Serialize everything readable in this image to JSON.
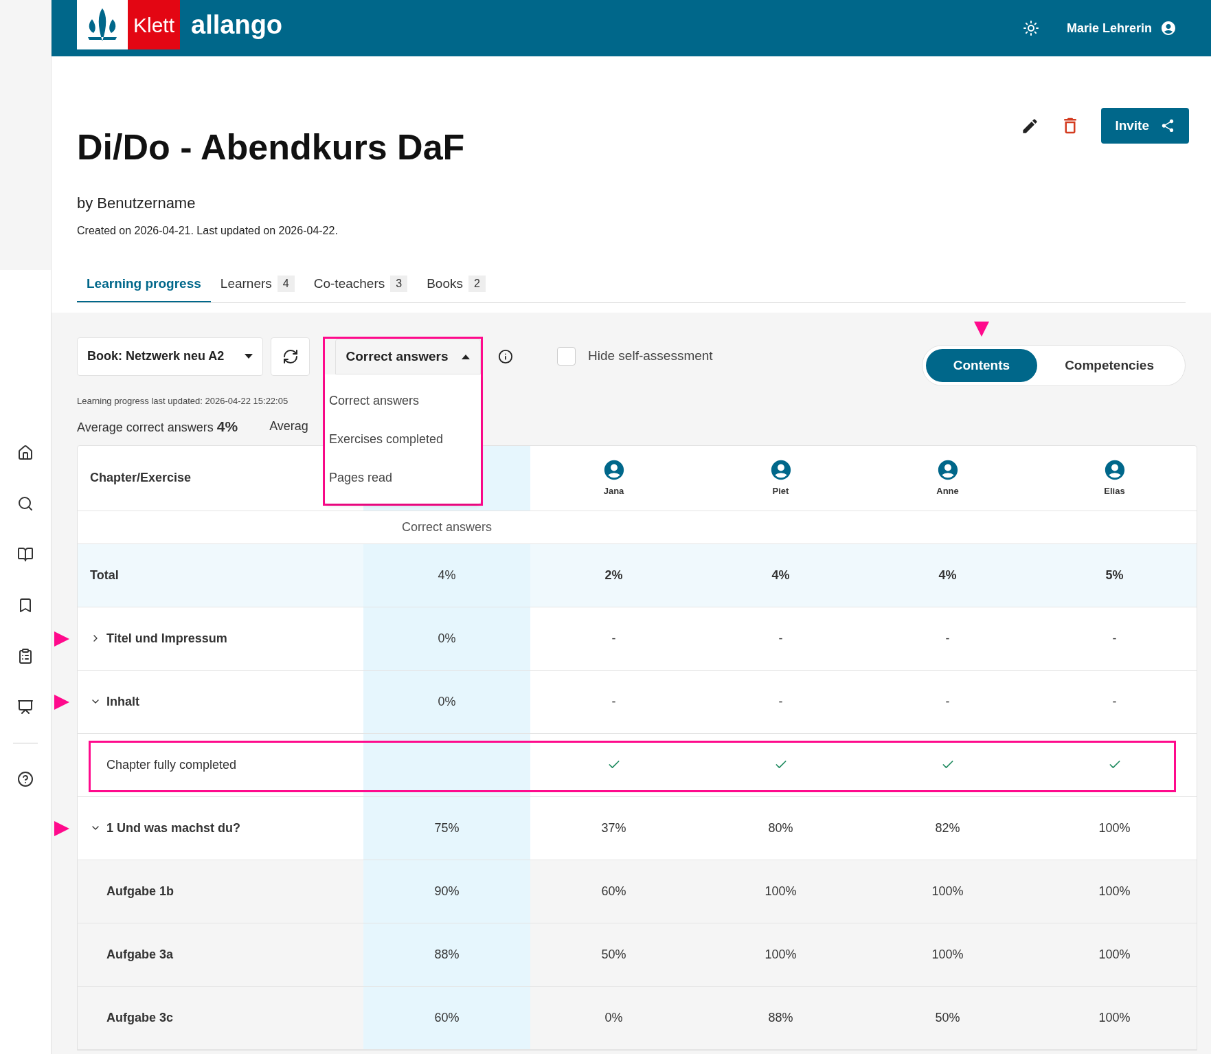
{
  "header": {
    "logo_mark": "Klett",
    "logo_text": "allango",
    "user": "Marie Lehrerin"
  },
  "course": {
    "title": "Di/Do - Abendkurs DaF",
    "author": "by Benutzername",
    "dates": "Created on 2026-04-21. Last updated on 2026-04-22.",
    "invite": "Invite"
  },
  "tabs": [
    {
      "label": "Learning progress",
      "selected": true
    },
    {
      "label": "Learners",
      "count": "4",
      "selected": false
    },
    {
      "label": "Co-teachers",
      "count": "3",
      "selected": false
    },
    {
      "label": "Books",
      "count": "2",
      "selected": false
    }
  ],
  "toolbar": {
    "book": "Book: Netzwerk neu A2",
    "metric": {
      "value": "Correct answers",
      "expanded": true,
      "highlighted": true,
      "options": [
        "Correct answers",
        "Exercises completed",
        "Pages read"
      ]
    },
    "hide_self_assessment": {
      "label": "Hide self-assessment",
      "checked": false
    },
    "last_updated": "Learning progress last updated: 2026-04-22 15:22:05",
    "stats": [
      {
        "label": "Average correct answers",
        "value": "4%"
      },
      {
        "label": "Averag"
      }
    ]
  },
  "view_toggle": [
    {
      "label": "Contents",
      "selected": true,
      "marked": true
    },
    {
      "label": "Competencies",
      "selected": false,
      "marked": false
    }
  ],
  "table": {
    "first_column": "Chapter/Exercise",
    "learners": [
      "Jana",
      "Piet",
      "Anne",
      "Elias"
    ],
    "metric_label": "Correct answers",
    "rows": [
      {
        "kind": "total",
        "label": "Total",
        "average": "4%",
        "values": [
          "2%",
          "4%",
          "4%",
          "5%"
        ]
      },
      {
        "kind": "chapter",
        "label": "Titel und Impressum",
        "expanded": false,
        "marked": true,
        "average": "0%",
        "values": [
          "-",
          "-",
          "-",
          "-"
        ]
      },
      {
        "kind": "chapter",
        "label": "Inhalt",
        "expanded": true,
        "marked": true,
        "average": "0%",
        "values": [
          "-",
          "-",
          "-",
          "-"
        ]
      },
      {
        "kind": "completion",
        "label": "Chapter fully completed",
        "highlighted": true,
        "checks": [
          true,
          true,
          true,
          true
        ]
      },
      {
        "kind": "chapter",
        "label": "1 Und was machst du?",
        "expanded": true,
        "marked": true,
        "average": "75%",
        "values": [
          "37%",
          "80%",
          "82%",
          "100%"
        ]
      },
      {
        "kind": "exercise",
        "label": "Aufgabe 1b",
        "average": "90%",
        "values": [
          "60%",
          "100%",
          "100%",
          "100%"
        ]
      },
      {
        "kind": "exercise",
        "label": "Aufgabe 3a",
        "average": "88%",
        "values": [
          "50%",
          "100%",
          "100%",
          "100%"
        ]
      },
      {
        "kind": "exercise",
        "label": "Aufgabe 3c",
        "average": "60%",
        "values": [
          "0%",
          "88%",
          "50%",
          "100%"
        ]
      }
    ]
  }
}
